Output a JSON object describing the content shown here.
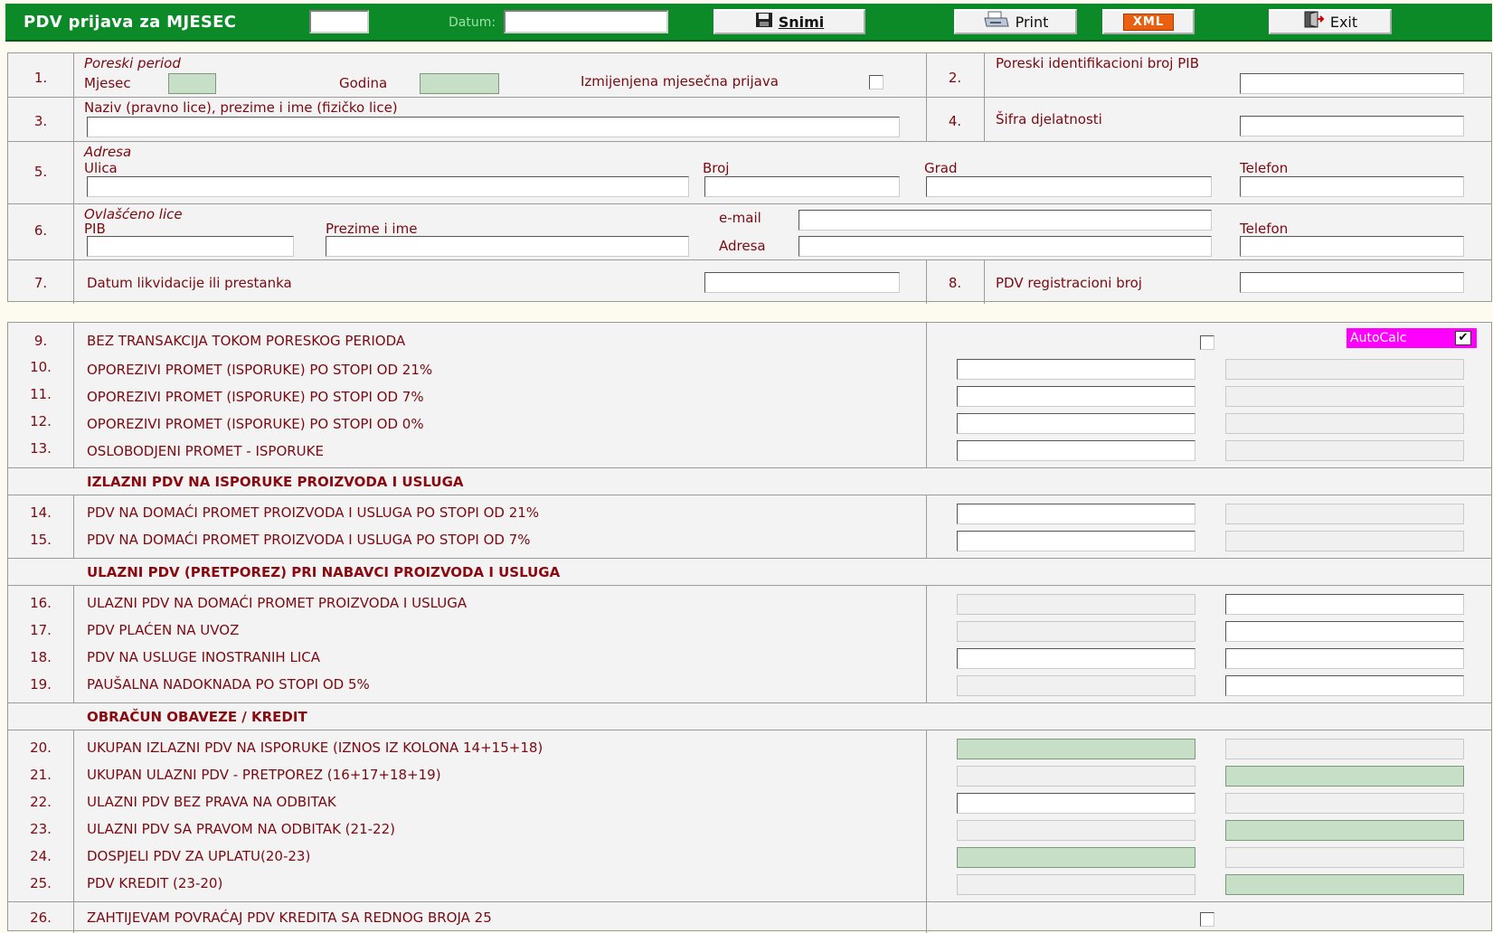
{
  "toolbar": {
    "title": "PDV prijava za MJESEC",
    "month_value": "",
    "datum_label": "Datum:",
    "datum_value": "",
    "save_label": "Snimi",
    "print_label": "Print",
    "xml_label": "XML",
    "exit_label": "Exit"
  },
  "header": {
    "r1": {
      "num": "1.",
      "title": "Poreski period",
      "mjesec": "Mjesec",
      "godina": "Godina",
      "amended": "Izmijenjena mjesečna prijava"
    },
    "r2": {
      "num": "2.",
      "label": "Poreski identifikacioni broj PIB"
    },
    "r3": {
      "num": "3.",
      "label": "Naziv (pravno lice), prezime i ime (fizičko lice)"
    },
    "r4": {
      "num": "4.",
      "label": "Šifra djelatnosti"
    },
    "r5": {
      "num": "5.",
      "title": "Adresa",
      "ulica": "Ulica",
      "broj": "Broj",
      "grad": "Grad",
      "telefon": "Telefon"
    },
    "r6": {
      "num": "6.",
      "title": "Ovlašćeno lice",
      "pib": "PIB",
      "prezime": "Prezime i ime",
      "email": "e-mail",
      "adresa": "Adresa",
      "telefon": "Telefon"
    },
    "r7": {
      "num": "7.",
      "label": "Datum likvidacije ili prestanka"
    },
    "r8": {
      "num": "8.",
      "label": "PDV registracioni broj"
    }
  },
  "autocalc": {
    "label": "AutoCalc",
    "checked": "✔"
  },
  "lines": {
    "l9": {
      "num": "9.",
      "label": "BEZ TRANSAKCIJA TOKOM PORESKOG PERIODA"
    },
    "l10": {
      "num": "10.",
      "label": "OPOREZIVI PROMET (ISPORUKE) PO STOPI OD 21%"
    },
    "l11": {
      "num": "11.",
      "label": "OPOREZIVI PROMET (ISPORUKE) PO STOPI OD 7%"
    },
    "l12": {
      "num": "12.",
      "label": "OPOREZIVI PROMET (ISPORUKE) PO STOPI OD 0%"
    },
    "l13": {
      "num": "13.",
      "label": "OSLOBODJENI PROMET - ISPORUKE"
    },
    "h1": "IZLAZNI PDV NA ISPORUKE PROIZVODA I USLUGA",
    "l14": {
      "num": "14.",
      "label": "PDV NA DOMAĆI PROMET PROIZVODA I USLUGA PO STOPI OD 21%"
    },
    "l15": {
      "num": "15.",
      "label": "PDV NA DOMAĆI PROMET PROIZVODA I USLUGA PO STOPI OD 7%"
    },
    "h2": "ULAZNI PDV (PRETPOREZ) PRI NABAVCI PROIZVODA I USLUGA",
    "l16": {
      "num": "16.",
      "label": "ULAZNI PDV NA DOMAĆI PROMET PROIZVODA I USLUGA"
    },
    "l17": {
      "num": "17.",
      "label": "PDV PLAĆEN NA UVOZ"
    },
    "l18": {
      "num": "18.",
      "label": "PDV NA USLUGE INOSTRANIH LICA"
    },
    "l19": {
      "num": "19.",
      "label": "PAUŠALNA NADOKNADA PO STOPI OD 5%"
    },
    "h3": "OBRAČUN OBAVEZE / KREDIT",
    "l20": {
      "num": "20.",
      "label": "UKUPAN IZLAZNI PDV NA ISPORUKE (IZNOS IZ KOLONA 14+15+18)"
    },
    "l21": {
      "num": "21.",
      "label": "UKUPAN ULAZNI PDV - PRETPOREZ (16+17+18+19)"
    },
    "l22": {
      "num": "22.",
      "label": "ULAZNI PDV BEZ PRAVA NA ODBITAK"
    },
    "l23": {
      "num": "23.",
      "label": "ULAZNI PDV SA PRAVOM NA ODBITAK (21-22)"
    },
    "l24": {
      "num": "24.",
      "label": "DOSPJELI PDV ZA UPLATU(20-23)"
    },
    "l25": {
      "num": "25.",
      "label": "PDV KREDIT (23-20)"
    },
    "l26": {
      "num": "26.",
      "label": "ZAHTIJEVAM POVRAĆAJ PDV KREDITA SA REDNOG BROJA 25"
    }
  },
  "colors": {
    "toolbar_green": "#0c8a28",
    "label_red": "#7a0a12",
    "field_green": "#c6dfc6",
    "autocalc_magenta": "#ff00ff",
    "xml_orange": "#e86010"
  }
}
